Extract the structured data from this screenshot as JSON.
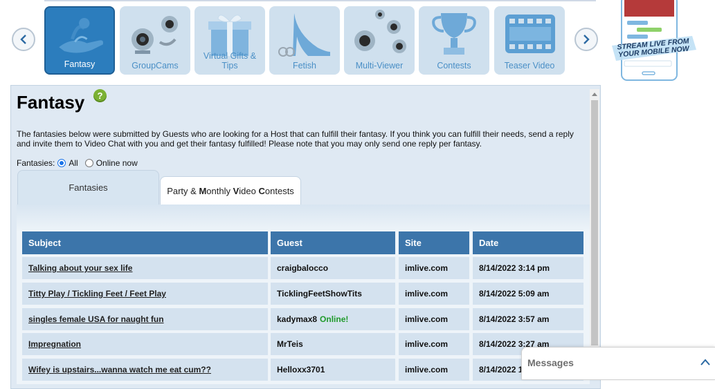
{
  "categories": [
    {
      "label": "Fantasy",
      "icon": "genie-lamp-icon",
      "active": true
    },
    {
      "label": "GroupCams",
      "icon": "group-webcams-icon",
      "active": false
    },
    {
      "label": "Virtual Gifts & Tips",
      "icon": "gift-box-icon",
      "active": false
    },
    {
      "label": "Fetish",
      "icon": "high-heel-icon",
      "active": false
    },
    {
      "label": "Multi-Viewer",
      "icon": "multi-webcam-icon",
      "active": false
    },
    {
      "label": "Contests",
      "icon": "trophy-icon",
      "active": false
    },
    {
      "label": "Teaser Video",
      "icon": "film-strip-icon",
      "active": false
    }
  ],
  "promo": {
    "line1": "STREAM LIVE FROM",
    "line2": "YOUR MOBILE NOW"
  },
  "page": {
    "title": "Fantasy",
    "intro": "The fantasies below were submitted by Guests who are looking for a Host that can fulfill their fantasy. If you think you can fulfill their needs, send a reply and invite them to Video Chat with you and get their fantasy fulfilled! Please note that you may only send one reply per fantasy."
  },
  "filter": {
    "label": "Fantasies:",
    "options": [
      "All",
      "Online now"
    ],
    "selected": "All"
  },
  "tabs": {
    "fantasies": "Fantasies",
    "contests": "Party & Monthly Video Contests"
  },
  "table": {
    "headers": [
      "Subject",
      "Guest",
      "Site",
      "Date"
    ],
    "rows": [
      {
        "subject": "Talking about your sex life",
        "guest": "craigbalocco",
        "online": "",
        "site": "imlive.com",
        "date": "8/14/2022 3:14 pm"
      },
      {
        "subject": "Titty Play / Tickling Feet / Feet Play",
        "guest": "TicklingFeetShowTits",
        "online": "",
        "site": "imlive.com",
        "date": "8/14/2022 5:09 am"
      },
      {
        "subject": "singles female USA for naught fun",
        "guest": "kadymax8",
        "online": "Online!",
        "site": "imlive.com",
        "date": "8/14/2022 3:57 am"
      },
      {
        "subject": "Impregnation",
        "guest": "MrTeis",
        "online": "",
        "site": "imlive.com",
        "date": "8/14/2022 3:27 am"
      },
      {
        "subject": "Wifey is upstairs...wanna watch me eat cum??",
        "guest": "Helloxx3701",
        "online": "",
        "site": "imlive.com",
        "date": "8/14/2022 1:"
      }
    ]
  },
  "messages": {
    "label": "Messages"
  },
  "colors": {
    "header": "#3c75aa",
    "cell": "#d4e2ef",
    "online": "#1f9a2b",
    "tile": "#cfe0ee",
    "tile_active": "#2c7dbd"
  }
}
